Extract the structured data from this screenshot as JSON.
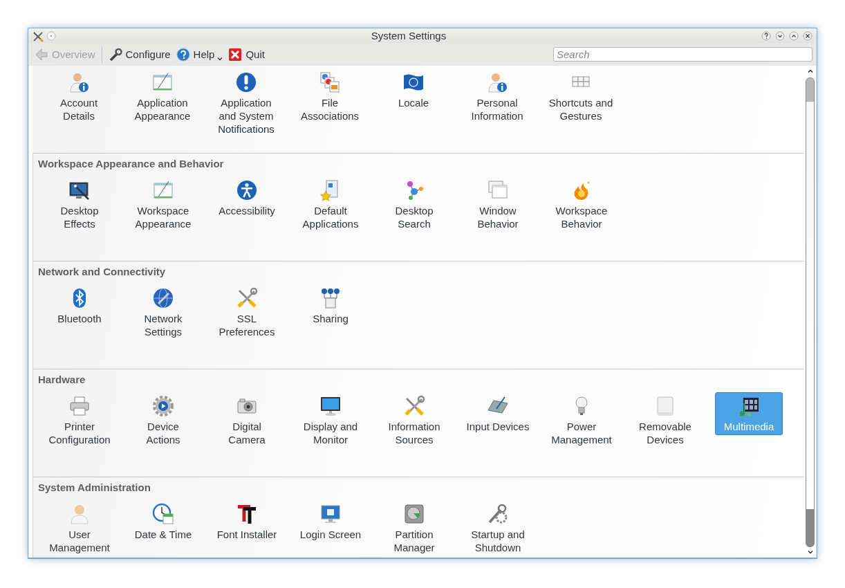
{
  "window": {
    "title": "System Settings"
  },
  "toolbar": [
    {
      "label": "Overview",
      "kind": "back",
      "disabled": true,
      "menu": false
    },
    {
      "label": "Configure",
      "kind": "configure",
      "disabled": false,
      "menu": false
    },
    {
      "label": "Help",
      "kind": "help",
      "disabled": false,
      "menu": true
    },
    {
      "label": "Quit",
      "kind": "quit",
      "disabled": false,
      "menu": false
    }
  ],
  "search": {
    "placeholder": "Search"
  },
  "groups": [
    {
      "items": [
        {
          "label": "Account Details",
          "kind": "user-info",
          "selected": false
        },
        {
          "label": "Application Appearance",
          "kind": "window-pen",
          "selected": false
        },
        {
          "label": "Application and System Notifications",
          "kind": "exclamation",
          "selected": false
        },
        {
          "label": "File Associations",
          "kind": "documents",
          "selected": false
        },
        {
          "label": "Locale",
          "kind": "flag",
          "selected": false
        },
        {
          "label": "Personal Information",
          "kind": "user-info",
          "selected": false
        },
        {
          "label": "Shortcuts and Gestures",
          "kind": "keyboard",
          "selected": false
        }
      ]
    },
    {
      "title": "Workspace Appearance and Behavior",
      "items": [
        {
          "label": "Desktop Effects",
          "kind": "monitor-wand",
          "selected": false
        },
        {
          "label": "Workspace Appearance",
          "kind": "window-pen",
          "selected": false
        },
        {
          "label": "Accessibility",
          "kind": "accessibility",
          "selected": false
        },
        {
          "label": "Default Applications",
          "kind": "star-document",
          "selected": false
        },
        {
          "label": "Desktop Search",
          "kind": "dots",
          "selected": false
        },
        {
          "label": "Window Behavior",
          "kind": "windows",
          "selected": false
        },
        {
          "label": "Workspace Behavior",
          "kind": "flame",
          "selected": false
        }
      ]
    },
    {
      "title": "Network and Connectivity",
      "items": [
        {
          "label": "Bluetooth",
          "kind": "bluetooth",
          "selected": false
        },
        {
          "label": "Network Settings",
          "kind": "globe",
          "selected": false
        },
        {
          "label": "SSL Preferences",
          "kind": "tools",
          "selected": false
        },
        {
          "label": "Sharing",
          "kind": "sharing",
          "selected": false
        }
      ]
    },
    {
      "title": "Hardware",
      "items": [
        {
          "label": "Printer Configuration",
          "kind": "printer",
          "selected": false
        },
        {
          "label": "Device Actions",
          "kind": "gear",
          "selected": false
        },
        {
          "label": "Digital Camera",
          "kind": "camera",
          "selected": false
        },
        {
          "label": "Display and Monitor",
          "kind": "monitor",
          "selected": false
        },
        {
          "label": "Information Sources",
          "kind": "tools",
          "selected": false
        },
        {
          "label": "Input Devices",
          "kind": "tablet",
          "selected": false
        },
        {
          "label": "Power Management",
          "kind": "bulb",
          "selected": false
        },
        {
          "label": "Removable Devices",
          "kind": "drive",
          "selected": false
        },
        {
          "label": "Multimedia",
          "kind": "film",
          "selected": true
        }
      ]
    },
    {
      "title": "System Administration",
      "items": [
        {
          "label": "User Management",
          "kind": "user",
          "selected": false
        },
        {
          "label": "Date & Time",
          "kind": "clock",
          "selected": false
        },
        {
          "label": "Font Installer",
          "kind": "font",
          "selected": false
        },
        {
          "label": "Login Screen",
          "kind": "login",
          "selected": false
        },
        {
          "label": "Partition Manager",
          "kind": "disk",
          "selected": false
        },
        {
          "label": "Startup and Shutdown",
          "kind": "wrench-gear",
          "selected": false
        }
      ]
    }
  ]
}
